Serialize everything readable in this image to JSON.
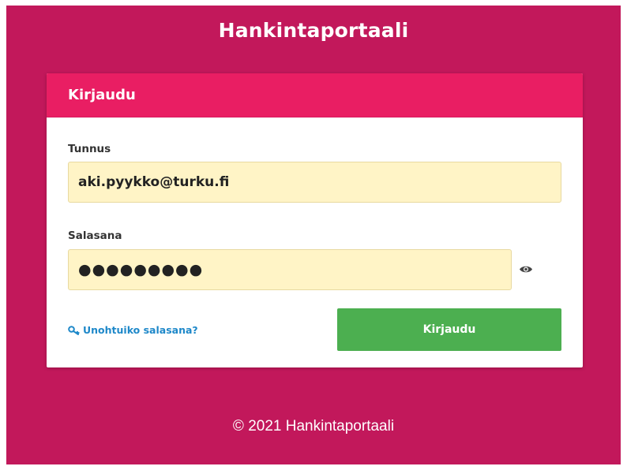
{
  "app": {
    "title": "Hankintaportaali"
  },
  "login_card": {
    "title": "Kirjaudu",
    "username": {
      "label": "Tunnus",
      "value": "aki.pyykko@turku.fi"
    },
    "password": {
      "label": "Salasana",
      "value": "●●●●●●●●●",
      "show_icon": "eye-icon"
    },
    "forgot_link": {
      "icon": "key-icon",
      "label": "Unohtuiko salasana?"
    },
    "submit_label": "Kirjaudu"
  },
  "footer": {
    "copyright": "© 2021 Hankintaportaali"
  },
  "colors": {
    "background": "#c2185b",
    "header": "#e91e63",
    "input_fill": "#fff4c6",
    "button": "#4caf50",
    "link": "#1e88c9"
  }
}
